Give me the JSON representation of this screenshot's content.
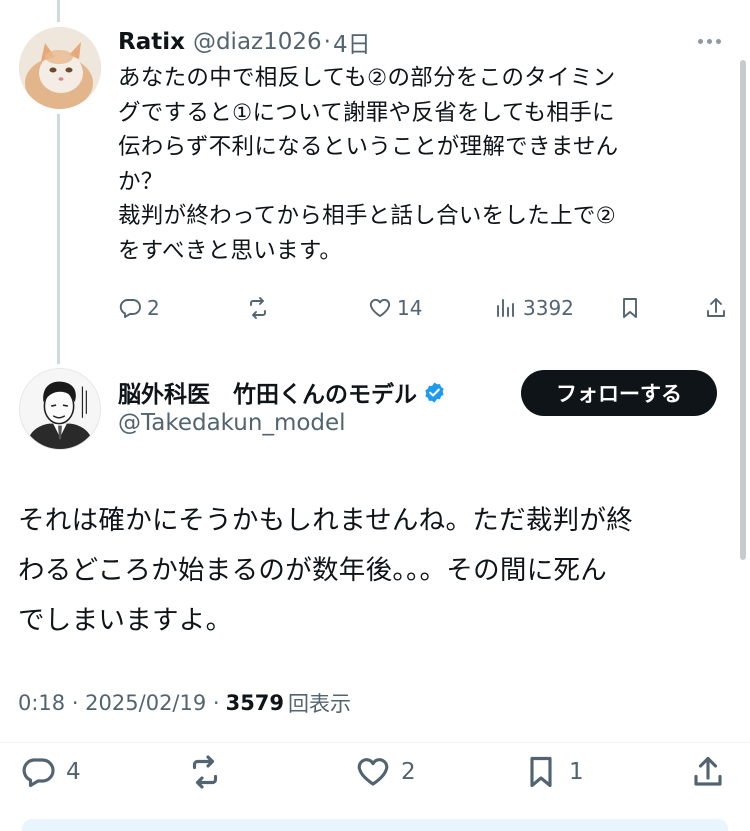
{
  "reply": {
    "display_name": "Ratix",
    "handle": "@diaz1026",
    "separator": "·",
    "time": "4日",
    "text": "あなたの中で相反しても②の部分をこのタイミン\nグですると①について謝罪や反省をしても相手に\n伝わらず不利になるということが理解できません\nか？\n裁判が終わってから相手と話し合いをした上で②\nをすべきと思います。",
    "replies": "2",
    "reposts": "",
    "likes": "14",
    "views": "3392"
  },
  "main": {
    "display_name": "脳外科医　竹田くんのモデル",
    "handle": "@Takedakun_model",
    "follow_label": "フォローする",
    "text": "それは確かにそうかもしれませんね。ただ裁判が終\nわるどころか始まるのが数年後。。。その間に死ん\nでしまいますよ。",
    "timestamp": "0:18 · 2025/02/19 ·",
    "views_count": "3579",
    "views_label": "回表示",
    "replies": "4",
    "reposts": "",
    "likes": "2",
    "bookmarks": "1"
  },
  "colors": {
    "text_primary": "#0f1419",
    "text_secondary": "#536471",
    "thread_line": "#cfd9de",
    "verified": "#1d9bf0",
    "follow_bg": "#0f1419"
  },
  "icons": [
    "more-icon",
    "reply-icon",
    "repost-icon",
    "like-icon",
    "views-icon",
    "bookmark-icon",
    "share-icon",
    "verified-badge-icon"
  ]
}
